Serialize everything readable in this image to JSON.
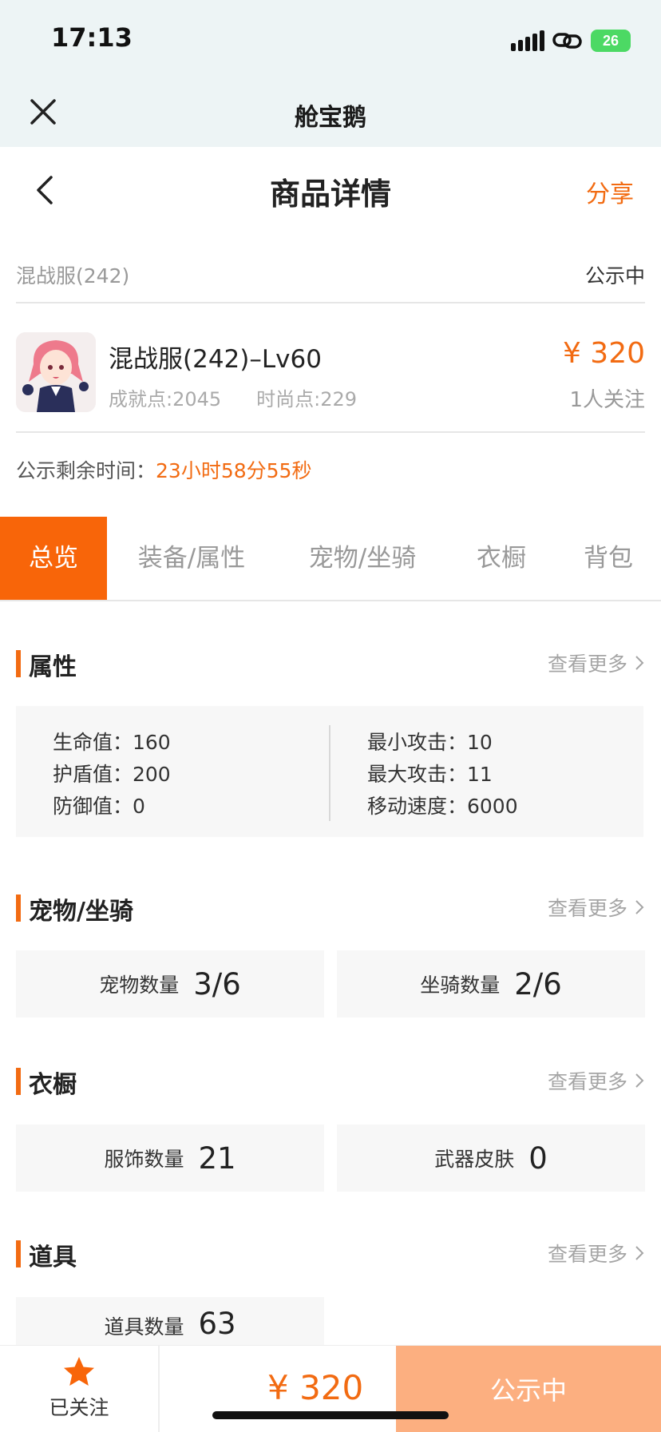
{
  "status_bar": {
    "time": "17:13",
    "battery": "26"
  },
  "miniapp": {
    "title": "舱宝鹅"
  },
  "nav": {
    "title": "商品详情",
    "share": "分享"
  },
  "server": {
    "name": "混战服(242)",
    "status": "公示中"
  },
  "product": {
    "title": "混战服(242)–Lv60",
    "achievement": "成就点:2045",
    "fashion": "时尚点:229",
    "price": "¥ 320",
    "followers": "1人关注"
  },
  "countdown": {
    "label": "公示剩余时间：",
    "value": "23小时58分55秒"
  },
  "tabs": [
    {
      "label": "总览",
      "active": true
    },
    {
      "label": "装备/属性"
    },
    {
      "label": "宠物/坐骑"
    },
    {
      "label": "衣橱"
    },
    {
      "label": "背包"
    }
  ],
  "more_label": "查看更多",
  "attributes": {
    "title": "属性",
    "left": [
      "生命值：160",
      "护盾值：200",
      "防御值：0"
    ],
    "right": [
      "最小攻击：10",
      "最大攻击：11",
      "移动速度：6000"
    ]
  },
  "pets": {
    "title": "宠物/坐骑",
    "cards": [
      {
        "label": "宠物数量",
        "value": "3/6"
      },
      {
        "label": "坐骑数量",
        "value": "2/6"
      }
    ]
  },
  "wardrobe": {
    "title": "衣橱",
    "cards": [
      {
        "label": "服饰数量",
        "value": "21"
      },
      {
        "label": "武器皮肤",
        "value": "0"
      }
    ]
  },
  "items": {
    "title": "道具",
    "cards": [
      {
        "label": "道具数量",
        "value": "63"
      }
    ]
  },
  "bottom": {
    "follow_label": "已关注",
    "price": "¥ 320",
    "status": "公示中"
  },
  "colors": {
    "accent": "#f26b12",
    "tab_active": "#f86509",
    "status_button": "#fcaf80"
  }
}
